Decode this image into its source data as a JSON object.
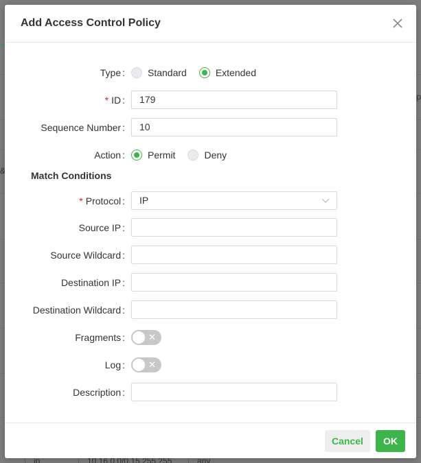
{
  "background": {
    "bottom_row": [
      "ip",
      "10.16.0.0/0.15.255.255",
      "any"
    ],
    "side_text_right": "p",
    "side_text_left": "&"
  },
  "modal": {
    "title": "Add Access Control Policy",
    "close_icon": "close-icon"
  },
  "form": {
    "type": {
      "label": "Type",
      "options": [
        {
          "label": "Standard",
          "checked": false
        },
        {
          "label": "Extended",
          "checked": true
        }
      ]
    },
    "id": {
      "label": "ID",
      "required": true,
      "value": "179"
    },
    "sequence_number": {
      "label": "Sequence Number",
      "value": "10"
    },
    "action": {
      "label": "Action",
      "options": [
        {
          "label": "Permit",
          "checked": true
        },
        {
          "label": "Deny",
          "checked": false
        }
      ]
    },
    "match_conditions_title": "Match Conditions",
    "protocol": {
      "label": "Protocol",
      "required": true,
      "value": "IP"
    },
    "source_ip": {
      "label": "Source IP",
      "value": ""
    },
    "source_wildcard": {
      "label": "Source Wildcard",
      "value": ""
    },
    "destination_ip": {
      "label": "Destination IP",
      "value": ""
    },
    "destination_wildcard": {
      "label": "Destination Wildcard",
      "value": ""
    },
    "fragments": {
      "label": "Fragments",
      "on": false,
      "off_glyph": "✕"
    },
    "log": {
      "label": "Log",
      "on": false,
      "off_glyph": "✕"
    },
    "description": {
      "label": "Description",
      "value": ""
    }
  },
  "footer": {
    "cancel_label": "Cancel",
    "ok_label": "OK"
  },
  "colors": {
    "accent": "#3eb54a",
    "required": "#e02020",
    "overlay": "#7e7e7e"
  }
}
